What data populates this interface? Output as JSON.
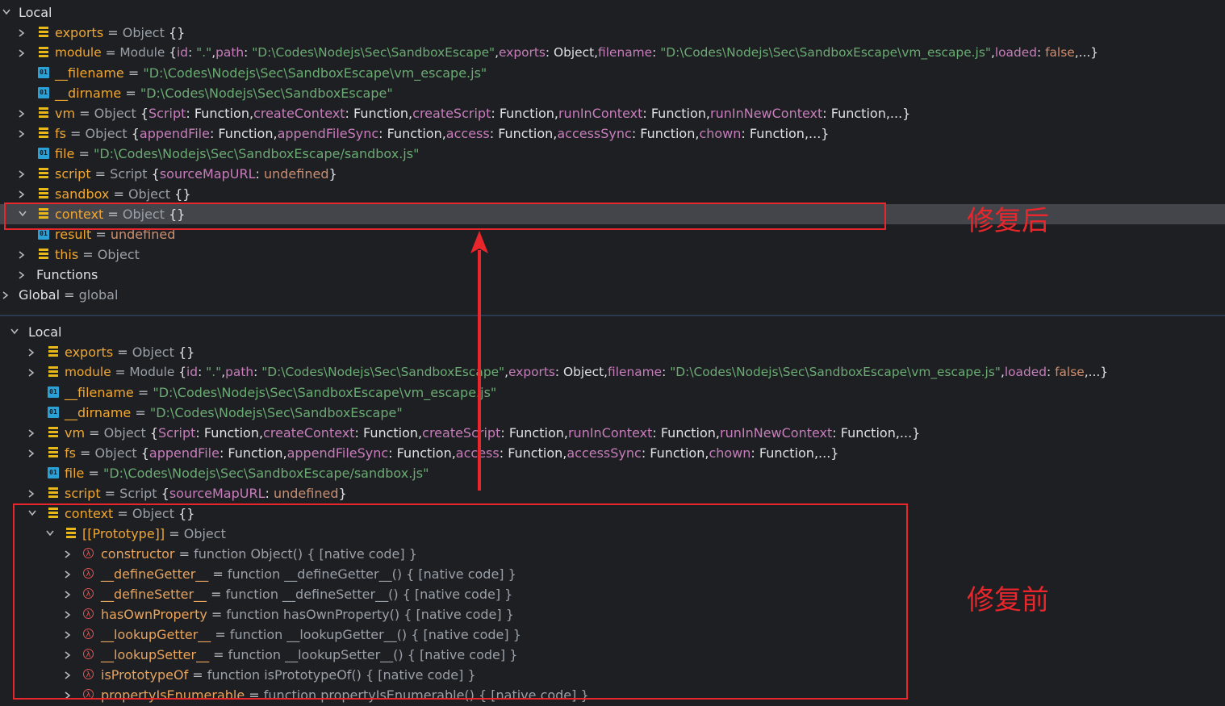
{
  "top": {
    "local_label": "Local",
    "rows": {
      "exports": {
        "name": "exports",
        "eq": " = ",
        "type": "Object",
        "rest": " {}"
      },
      "module": {
        "name": "module",
        "eq": " = ",
        "type": "Module",
        "b1": " {",
        "id_k": "id",
        "c1": ": ",
        "id_v": "\".\"",
        "c2": ",",
        "path_k": "path",
        "c3": ": ",
        "path_v": "\"D:\\Codes\\Nodejs\\Sec\\SandboxEscape\"",
        "c4": ",",
        "exp_k": "exports",
        "c5": ": Object,",
        "fn_k": "filename",
        "c6": ": ",
        "fn_v": "\"D:\\Codes\\Nodejs\\Sec\\SandboxEscape\\vm_escape.js\"",
        "c7": ",",
        "ld_k": "loaded",
        "c8": ": ",
        "ld_v": "false",
        "c9": ",...}"
      },
      "filename": {
        "name": "__filename",
        "eq": " = ",
        "val": "\"D:\\Codes\\Nodejs\\Sec\\SandboxEscape\\vm_escape.js\""
      },
      "dirname": {
        "name": "__dirname",
        "eq": " = ",
        "val": "\"D:\\Codes\\Nodejs\\Sec\\SandboxEscape\""
      },
      "vm": {
        "name": "vm",
        "eq": " = ",
        "type": "Object",
        "b1": " {",
        "k1": "Script",
        "v1": ": Function,",
        "k2": "createContext",
        "v2": ": Function,",
        "k3": "createScript",
        "v3": ": Function,",
        "k4": "runInContext",
        "v4": ": Function,",
        "k5": "runInNewContext",
        "v5": ": Function,...}"
      },
      "fs": {
        "name": "fs",
        "eq": " = ",
        "type": "Object",
        "b1": " {",
        "k1": "appendFile",
        "v1": ": Function,",
        "k2": "appendFileSync",
        "v2": ": Function,",
        "k3": "access",
        "v3": ": Function,",
        "k4": "accessSync",
        "v4": ": Function,",
        "k5": "chown",
        "v5": ": Function,...}"
      },
      "file": {
        "name": "file",
        "eq": " = ",
        "val": "\"D:\\Codes\\Nodejs\\Sec\\SandboxEscape/sandbox.js\""
      },
      "script": {
        "name": "script",
        "eq": " = ",
        "type": "Script",
        "b1": " {",
        "k1": "sourceMapURL",
        "v1": ": ",
        "u1": "undefined",
        "b2": "}"
      },
      "sandbox": {
        "name": "sandbox",
        "eq": " = ",
        "type": "Object",
        "rest": " {}"
      },
      "context": {
        "name": "context",
        "eq": " = ",
        "type": "Object",
        "rest": " {}"
      },
      "result": {
        "name": "result",
        "eq": " = ",
        "val": "undefined"
      },
      "this": {
        "name": "this",
        "eq": " = ",
        "type": "Object"
      },
      "functions": {
        "label": "Functions"
      },
      "global": {
        "name": "Global",
        "eq": " = ",
        "type": "global"
      }
    }
  },
  "bottom": {
    "local_label": "Local",
    "rows": {
      "exports": {
        "name": "exports",
        "eq": " = ",
        "type": "Object",
        "rest": " {}"
      },
      "module": {
        "name": "module",
        "eq": " = ",
        "type": "Module",
        "b1": " {",
        "id_k": "id",
        "c1": ": ",
        "id_v": "\".\"",
        "c2": ",",
        "path_k": "path",
        "c3": ": ",
        "path_v": "\"D:\\Codes\\Nodejs\\Sec\\SandboxEscape\"",
        "c4": ",",
        "exp_k": "exports",
        "c5": ": Object,",
        "fn_k": "filename",
        "c6": ": ",
        "fn_v": "\"D:\\Codes\\Nodejs\\Sec\\SandboxEscape\\vm_escape.js\"",
        "c7": ",",
        "ld_k": "loaded",
        "c8": ": ",
        "ld_v": "false",
        "c9": ",...}"
      },
      "filename": {
        "name": "__filename",
        "eq": " = ",
        "val": "\"D:\\Codes\\Nodejs\\Sec\\SandboxEscape\\vm_escape.js\""
      },
      "dirname": {
        "name": "__dirname",
        "eq": " = ",
        "val": "\"D:\\Codes\\Nodejs\\Sec\\SandboxEscape\""
      },
      "vm": {
        "name": "vm",
        "eq": " = ",
        "type": "Object",
        "b1": " {",
        "k1": "Script",
        "v1": ": Function,",
        "k2": "createContext",
        "v2": ": Function,",
        "k3": "createScript",
        "v3": ": Function,",
        "k4": "runInContext",
        "v4": ": Function,",
        "k5": "runInNewContext",
        "v5": ": Function,...}"
      },
      "fs": {
        "name": "fs",
        "eq": " = ",
        "type": "Object",
        "b1": " {",
        "k1": "appendFile",
        "v1": ": Function,",
        "k2": "appendFileSync",
        "v2": ": Function,",
        "k3": "access",
        "v3": ": Function,",
        "k4": "accessSync",
        "v4": ": Function,",
        "k5": "chown",
        "v5": ": Function,...}"
      },
      "file": {
        "name": "file",
        "eq": " = ",
        "val": "\"D:\\Codes\\Nodejs\\Sec\\SandboxEscape/sandbox.js\""
      },
      "script": {
        "name": "script",
        "eq": " = ",
        "type": "Script",
        "b1": " {",
        "k1": "sourceMapURL",
        "v1": ": ",
        "u1": "undefined",
        "b2": "}"
      },
      "context": {
        "name": "context",
        "eq": " = ",
        "type": "Object",
        "rest": " {}"
      },
      "prototype": {
        "name": "[[Prototype]]",
        "eq": " = ",
        "type": "Object"
      },
      "fns": [
        {
          "name": "constructor",
          "eq": " = ",
          "val": "function Object() { [native code] }"
        },
        {
          "name": "__defineGetter__",
          "eq": " = ",
          "val": "function __defineGetter__() { [native code] }"
        },
        {
          "name": "__defineSetter__",
          "eq": " = ",
          "val": "function __defineSetter__() { [native code] }"
        },
        {
          "name": "hasOwnProperty",
          "eq": " = ",
          "val": "function hasOwnProperty() { [native code] }"
        },
        {
          "name": "__lookupGetter__",
          "eq": " = ",
          "val": "function __lookupGetter__() { [native code] }"
        },
        {
          "name": "__lookupSetter__",
          "eq": " = ",
          "val": "function __lookupSetter__() { [native code] }"
        },
        {
          "name": "isPrototypeOf",
          "eq": " = ",
          "val": "function isPrototypeOf() { [native code] }"
        },
        {
          "name": "propertyIsEnumerable",
          "eq": " = ",
          "val": "function propertyIsEnumerable() { [native code] }"
        }
      ]
    }
  },
  "annotations": {
    "after": "修复后",
    "before": "修复前",
    "color": "#e8262b"
  },
  "icons": {
    "object": "stack-icon",
    "primitive": "primitive-01-icon",
    "function": "lambda-icon",
    "prim_glyph": "01",
    "fn_glyph": "λ"
  }
}
